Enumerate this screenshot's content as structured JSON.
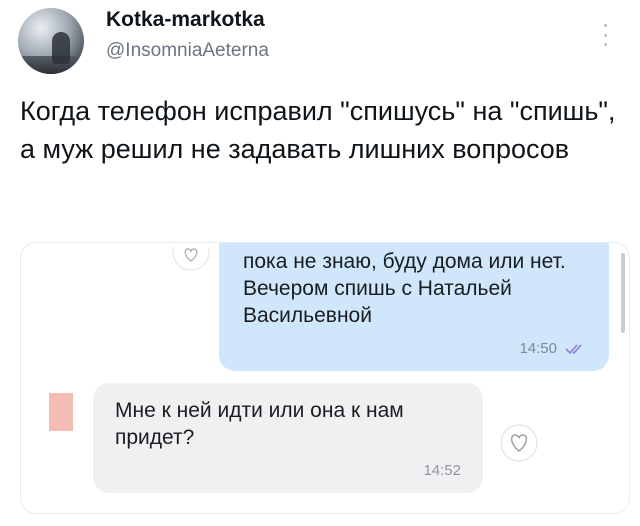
{
  "tweet": {
    "display_name": "Kotka-markotka",
    "handle": "@InsomniaAeterna",
    "text": "Когда телефон исправил \"спишусь\" на \"спишь\", а муж решил не задавать лишних вопросов"
  },
  "screenshot": {
    "messages": [
      {
        "direction": "outgoing",
        "text": "пока не знаю, буду дома или нет. Вечером спишь с Натальей Васильевной",
        "time": "14:50",
        "status_icon": "double-check-icon"
      },
      {
        "direction": "incoming",
        "text": "Мне к ней идти или она к нам придет?",
        "time": "14:52",
        "reaction_icon": "heart-outline-icon"
      }
    ],
    "colors": {
      "outgoing_bubble": "#cfe6fb",
      "incoming_bubble": "#f0f0f2",
      "check_color": "#8a7fd6"
    }
  }
}
